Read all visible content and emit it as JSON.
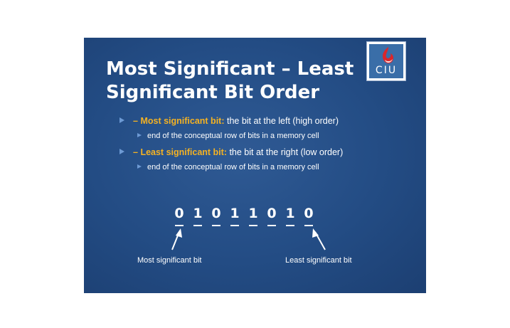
{
  "slide": {
    "title_line1": "Most Significant – Least",
    "title_line2": "Significant Bit Order",
    "logo_text": "CIU",
    "logo_color": "#d9262b",
    "background_color": "#234c84",
    "highlight_color": "#f4b223"
  },
  "bullets": [
    {
      "prefix": "– ",
      "term": "Most significant bit:",
      "text": " the bit at the left (high order)",
      "sub": "end of the conceptual row of bits in a memory cell"
    },
    {
      "prefix": "– ",
      "term": "Least significant bit:",
      "text": " the bit at the right (low order)",
      "sub": "end of the conceptual row of bits in a memory cell"
    }
  ],
  "bit_row": {
    "bits": [
      "0",
      "1",
      "0",
      "1",
      "1",
      "0",
      "1",
      "0"
    ],
    "left_caption": "Most significant bit",
    "right_caption": "Least significant bit"
  }
}
